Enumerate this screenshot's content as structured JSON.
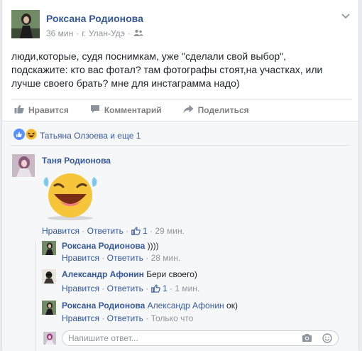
{
  "post": {
    "author": "Роксана Родионова",
    "time": "36 мин",
    "location": "г. Улан-Удэ",
    "text": "люди,которые, судя поснимкам, уже \"сделали свой выбор\", подскажите: кто вас фотал? там фотографы стоят,на участках, или лучше своего брать? мне для инстаграмма надо)"
  },
  "actions": {
    "like": "Нравится",
    "comment": "Комментарий",
    "share": "Поделиться"
  },
  "reactions": {
    "summary": "Татьяна Олзоева и еще 1"
  },
  "comments": [
    {
      "author": "Таня Родионова",
      "like": "Нравится",
      "reply": "Ответить",
      "likes": "1",
      "time": "29 мин."
    }
  ],
  "replies": [
    {
      "author": "Роксана Родионова",
      "text": "))))",
      "like": "Нравится",
      "reply": "Ответить",
      "time": "28 мин."
    },
    {
      "author": "Александр Афонин",
      "text": "Бери своего)",
      "like": "Нравится",
      "reply": "Ответить",
      "likes": "1",
      "time": "1 мин."
    },
    {
      "author": "Роксана Родионова",
      "mention": "Александр Афонин",
      "text": "ок)",
      "like": "Нравится",
      "reply": "Ответить",
      "time": "Только что"
    }
  ],
  "reply_input": {
    "placeholder": "Напишите ответ..."
  },
  "icons": {
    "friends": "friends-icon",
    "chevron": "chevron-down-icon",
    "thumb": "thumbs-up-icon",
    "comment": "comment-icon",
    "share": "share-icon",
    "camera": "camera-icon",
    "smile": "smile-icon"
  },
  "colors": {
    "link": "#365899",
    "like_blue": "#5890ff"
  }
}
